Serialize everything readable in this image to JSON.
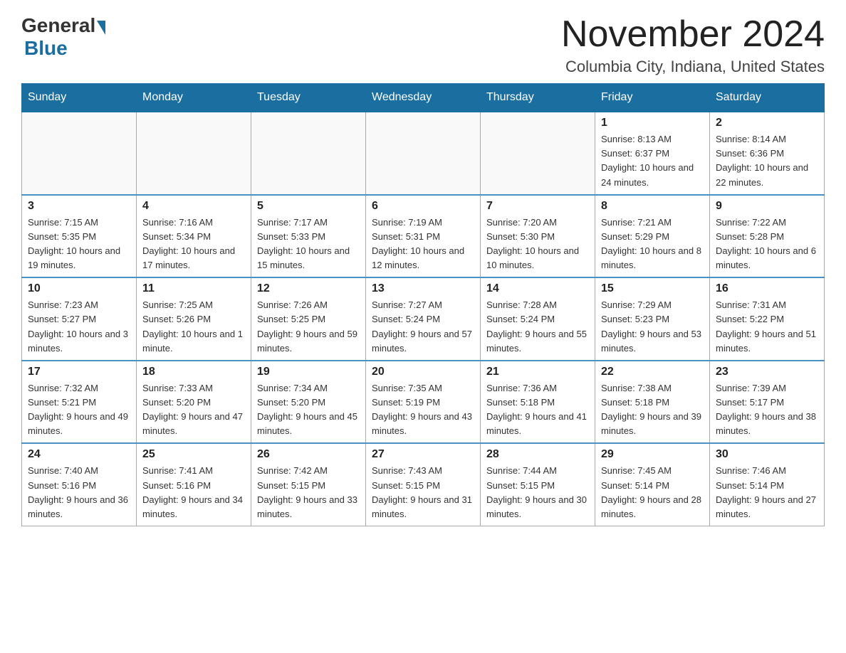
{
  "header": {
    "logo_general": "General",
    "logo_blue": "Blue",
    "month_title": "November 2024",
    "location": "Columbia City, Indiana, United States"
  },
  "weekdays": [
    "Sunday",
    "Monday",
    "Tuesday",
    "Wednesday",
    "Thursday",
    "Friday",
    "Saturday"
  ],
  "weeks": [
    [
      {
        "day": "",
        "sunrise": "",
        "sunset": "",
        "daylight": ""
      },
      {
        "day": "",
        "sunrise": "",
        "sunset": "",
        "daylight": ""
      },
      {
        "day": "",
        "sunrise": "",
        "sunset": "",
        "daylight": ""
      },
      {
        "day": "",
        "sunrise": "",
        "sunset": "",
        "daylight": ""
      },
      {
        "day": "",
        "sunrise": "",
        "sunset": "",
        "daylight": ""
      },
      {
        "day": "1",
        "sunrise": "Sunrise: 8:13 AM",
        "sunset": "Sunset: 6:37 PM",
        "daylight": "Daylight: 10 hours and 24 minutes."
      },
      {
        "day": "2",
        "sunrise": "Sunrise: 8:14 AM",
        "sunset": "Sunset: 6:36 PM",
        "daylight": "Daylight: 10 hours and 22 minutes."
      }
    ],
    [
      {
        "day": "3",
        "sunrise": "Sunrise: 7:15 AM",
        "sunset": "Sunset: 5:35 PM",
        "daylight": "Daylight: 10 hours and 19 minutes."
      },
      {
        "day": "4",
        "sunrise": "Sunrise: 7:16 AM",
        "sunset": "Sunset: 5:34 PM",
        "daylight": "Daylight: 10 hours and 17 minutes."
      },
      {
        "day": "5",
        "sunrise": "Sunrise: 7:17 AM",
        "sunset": "Sunset: 5:33 PM",
        "daylight": "Daylight: 10 hours and 15 minutes."
      },
      {
        "day": "6",
        "sunrise": "Sunrise: 7:19 AM",
        "sunset": "Sunset: 5:31 PM",
        "daylight": "Daylight: 10 hours and 12 minutes."
      },
      {
        "day": "7",
        "sunrise": "Sunrise: 7:20 AM",
        "sunset": "Sunset: 5:30 PM",
        "daylight": "Daylight: 10 hours and 10 minutes."
      },
      {
        "day": "8",
        "sunrise": "Sunrise: 7:21 AM",
        "sunset": "Sunset: 5:29 PM",
        "daylight": "Daylight: 10 hours and 8 minutes."
      },
      {
        "day": "9",
        "sunrise": "Sunrise: 7:22 AM",
        "sunset": "Sunset: 5:28 PM",
        "daylight": "Daylight: 10 hours and 6 minutes."
      }
    ],
    [
      {
        "day": "10",
        "sunrise": "Sunrise: 7:23 AM",
        "sunset": "Sunset: 5:27 PM",
        "daylight": "Daylight: 10 hours and 3 minutes."
      },
      {
        "day": "11",
        "sunrise": "Sunrise: 7:25 AM",
        "sunset": "Sunset: 5:26 PM",
        "daylight": "Daylight: 10 hours and 1 minute."
      },
      {
        "day": "12",
        "sunrise": "Sunrise: 7:26 AM",
        "sunset": "Sunset: 5:25 PM",
        "daylight": "Daylight: 9 hours and 59 minutes."
      },
      {
        "day": "13",
        "sunrise": "Sunrise: 7:27 AM",
        "sunset": "Sunset: 5:24 PM",
        "daylight": "Daylight: 9 hours and 57 minutes."
      },
      {
        "day": "14",
        "sunrise": "Sunrise: 7:28 AM",
        "sunset": "Sunset: 5:24 PM",
        "daylight": "Daylight: 9 hours and 55 minutes."
      },
      {
        "day": "15",
        "sunrise": "Sunrise: 7:29 AM",
        "sunset": "Sunset: 5:23 PM",
        "daylight": "Daylight: 9 hours and 53 minutes."
      },
      {
        "day": "16",
        "sunrise": "Sunrise: 7:31 AM",
        "sunset": "Sunset: 5:22 PM",
        "daylight": "Daylight: 9 hours and 51 minutes."
      }
    ],
    [
      {
        "day": "17",
        "sunrise": "Sunrise: 7:32 AM",
        "sunset": "Sunset: 5:21 PM",
        "daylight": "Daylight: 9 hours and 49 minutes."
      },
      {
        "day": "18",
        "sunrise": "Sunrise: 7:33 AM",
        "sunset": "Sunset: 5:20 PM",
        "daylight": "Daylight: 9 hours and 47 minutes."
      },
      {
        "day": "19",
        "sunrise": "Sunrise: 7:34 AM",
        "sunset": "Sunset: 5:20 PM",
        "daylight": "Daylight: 9 hours and 45 minutes."
      },
      {
        "day": "20",
        "sunrise": "Sunrise: 7:35 AM",
        "sunset": "Sunset: 5:19 PM",
        "daylight": "Daylight: 9 hours and 43 minutes."
      },
      {
        "day": "21",
        "sunrise": "Sunrise: 7:36 AM",
        "sunset": "Sunset: 5:18 PM",
        "daylight": "Daylight: 9 hours and 41 minutes."
      },
      {
        "day": "22",
        "sunrise": "Sunrise: 7:38 AM",
        "sunset": "Sunset: 5:18 PM",
        "daylight": "Daylight: 9 hours and 39 minutes."
      },
      {
        "day": "23",
        "sunrise": "Sunrise: 7:39 AM",
        "sunset": "Sunset: 5:17 PM",
        "daylight": "Daylight: 9 hours and 38 minutes."
      }
    ],
    [
      {
        "day": "24",
        "sunrise": "Sunrise: 7:40 AM",
        "sunset": "Sunset: 5:16 PM",
        "daylight": "Daylight: 9 hours and 36 minutes."
      },
      {
        "day": "25",
        "sunrise": "Sunrise: 7:41 AM",
        "sunset": "Sunset: 5:16 PM",
        "daylight": "Daylight: 9 hours and 34 minutes."
      },
      {
        "day": "26",
        "sunrise": "Sunrise: 7:42 AM",
        "sunset": "Sunset: 5:15 PM",
        "daylight": "Daylight: 9 hours and 33 minutes."
      },
      {
        "day": "27",
        "sunrise": "Sunrise: 7:43 AM",
        "sunset": "Sunset: 5:15 PM",
        "daylight": "Daylight: 9 hours and 31 minutes."
      },
      {
        "day": "28",
        "sunrise": "Sunrise: 7:44 AM",
        "sunset": "Sunset: 5:15 PM",
        "daylight": "Daylight: 9 hours and 30 minutes."
      },
      {
        "day": "29",
        "sunrise": "Sunrise: 7:45 AM",
        "sunset": "Sunset: 5:14 PM",
        "daylight": "Daylight: 9 hours and 28 minutes."
      },
      {
        "day": "30",
        "sunrise": "Sunrise: 7:46 AM",
        "sunset": "Sunset: 5:14 PM",
        "daylight": "Daylight: 9 hours and 27 minutes."
      }
    ]
  ]
}
